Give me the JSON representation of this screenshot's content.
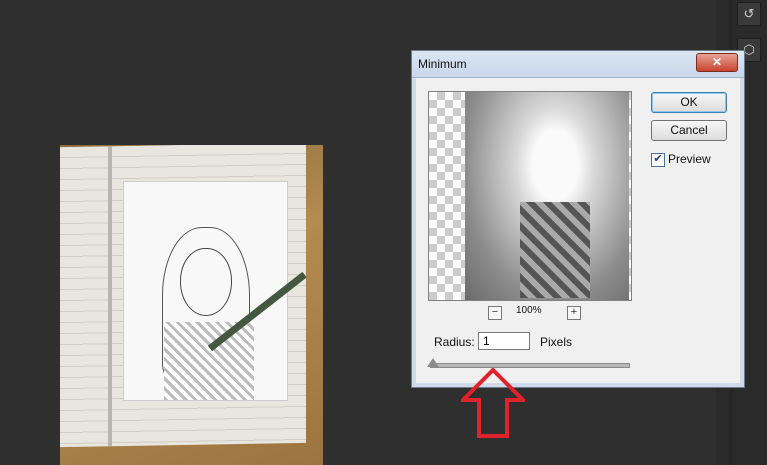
{
  "dialog": {
    "title": "Minimum",
    "close_glyph": "✕",
    "ok_label": "OK",
    "cancel_label": "Cancel",
    "preview_label": "Preview",
    "preview_checked": true,
    "zoom_minus": "−",
    "zoom_label": "100%",
    "zoom_plus": "+",
    "radius_label": "Radius:",
    "radius_value": "1",
    "radius_units": "Pixels"
  },
  "panel": {
    "history_icon": "history-icon",
    "layers_icon": "3d-cube-icon"
  },
  "colors": {
    "workspace": "#2f2f2f",
    "dialog_bg": "#f0f0f0",
    "close_red": "#c8442f",
    "annotation_red": "#e0222a"
  }
}
